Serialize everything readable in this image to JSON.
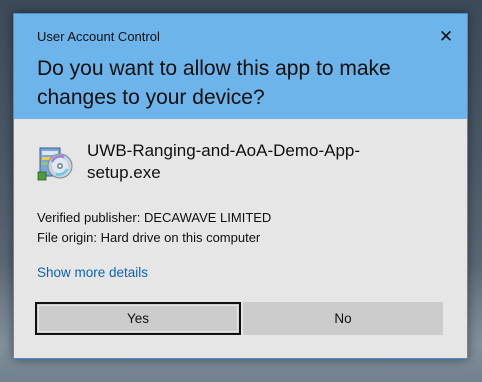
{
  "dialog": {
    "title": "User Account Control",
    "close_glyph": "✕",
    "question": "Do you want to allow this app to make changes to your device?",
    "app_name": "UWB-Ranging-and-AoA-Demo-App-setup.exe",
    "app_icon": "installer-disc-icon",
    "verified_publisher": "Verified publisher: DECAWAVE LIMITED",
    "file_origin": "File origin: Hard drive on this computer",
    "show_more_details": "Show more details",
    "yes_label": "Yes",
    "no_label": "No"
  },
  "colors": {
    "header": "#6cb4ea",
    "body": "#e6e6e6",
    "link": "#0e63b5",
    "button": "#cccccc"
  }
}
